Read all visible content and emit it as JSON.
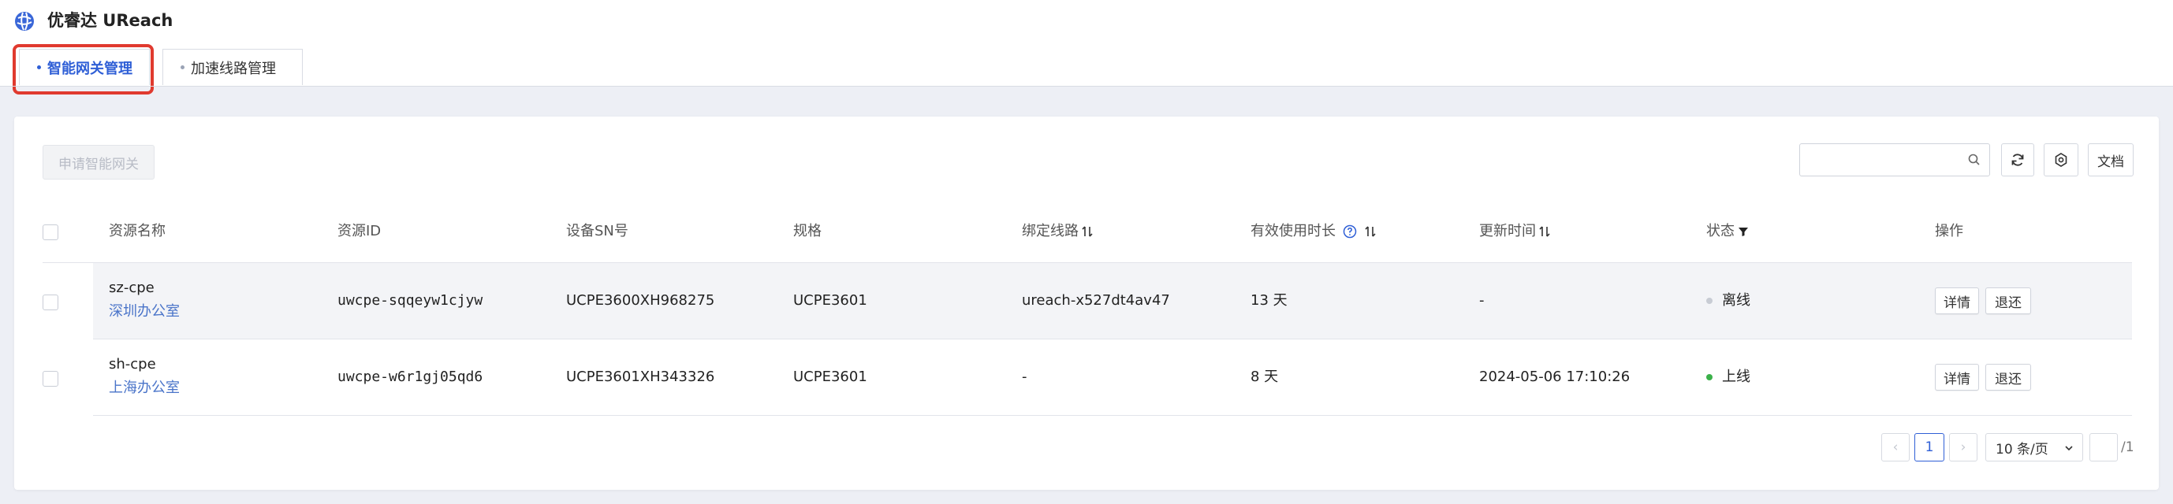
{
  "app": {
    "title": "优睿达 UReach"
  },
  "tabs": [
    {
      "label": "智能网关管理",
      "active": true
    },
    {
      "label": "加速线路管理",
      "active": false
    }
  ],
  "toolbar": {
    "apply_label": "申请智能网关",
    "search_placeholder": "",
    "doc_label": "文档"
  },
  "table": {
    "headers": {
      "name": "资源名称",
      "id": "资源ID",
      "sn": "设备SN号",
      "spec": "规格",
      "line": "绑定线路",
      "duration": "有效使用时长",
      "updated": "更新时间",
      "status": "状态",
      "ops": "操作"
    },
    "rows": [
      {
        "name": "sz-cpe",
        "office": "深圳办公室",
        "id": "uwcpe-sqqeyw1cjyw",
        "sn": "UCPE3600XH968275",
        "spec": "UCPE3601",
        "line": "ureach-x527dt4av47",
        "duration": "13 天",
        "updated": "-",
        "status": "离线",
        "status_color": "#c8ccd4",
        "detail_label": "详情",
        "return_label": "退还"
      },
      {
        "name": "sh-cpe",
        "office": "上海办公室",
        "id": "uwcpe-w6r1gj05qd6",
        "sn": "UCPE3601XH343326",
        "spec": "UCPE3601",
        "line": "-",
        "duration": "8 天",
        "updated": "2024-05-06 17:10:26",
        "status": "上线",
        "status_color": "#3bb14a",
        "detail_label": "详情",
        "return_label": "退还"
      }
    ]
  },
  "pagination": {
    "prev": "‹",
    "next": "›",
    "current_page": "1",
    "page_size": "10 条/页",
    "jump_value": "",
    "total_pages": "/1"
  },
  "colors": {
    "accent": "#2f5fd6",
    "highlight": "#e03a2f",
    "online": "#3bb14a",
    "offline": "#c8ccd4"
  }
}
